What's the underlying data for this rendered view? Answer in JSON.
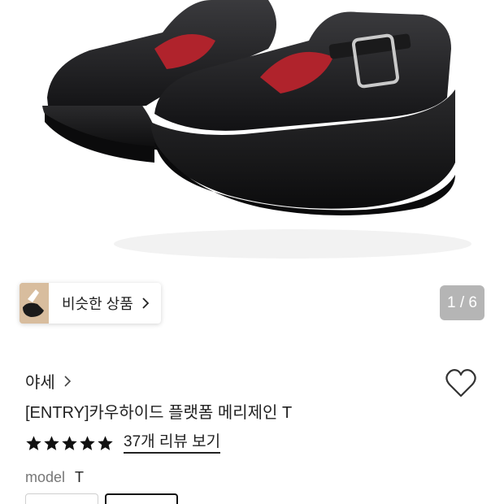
{
  "similar": {
    "label": "비슷한 상품"
  },
  "gallery": {
    "counter": "1 / 6"
  },
  "product": {
    "brand": "야세",
    "title": "[ENTRY]카우하이드 플랫폼 메리제인 T",
    "rating": 5,
    "reviews_link": "37개 리뷰 보기"
  },
  "options": {
    "label": "model",
    "selected": "T"
  },
  "colors": {
    "star": "#111111",
    "counter_bg": "#7a7a7a"
  }
}
